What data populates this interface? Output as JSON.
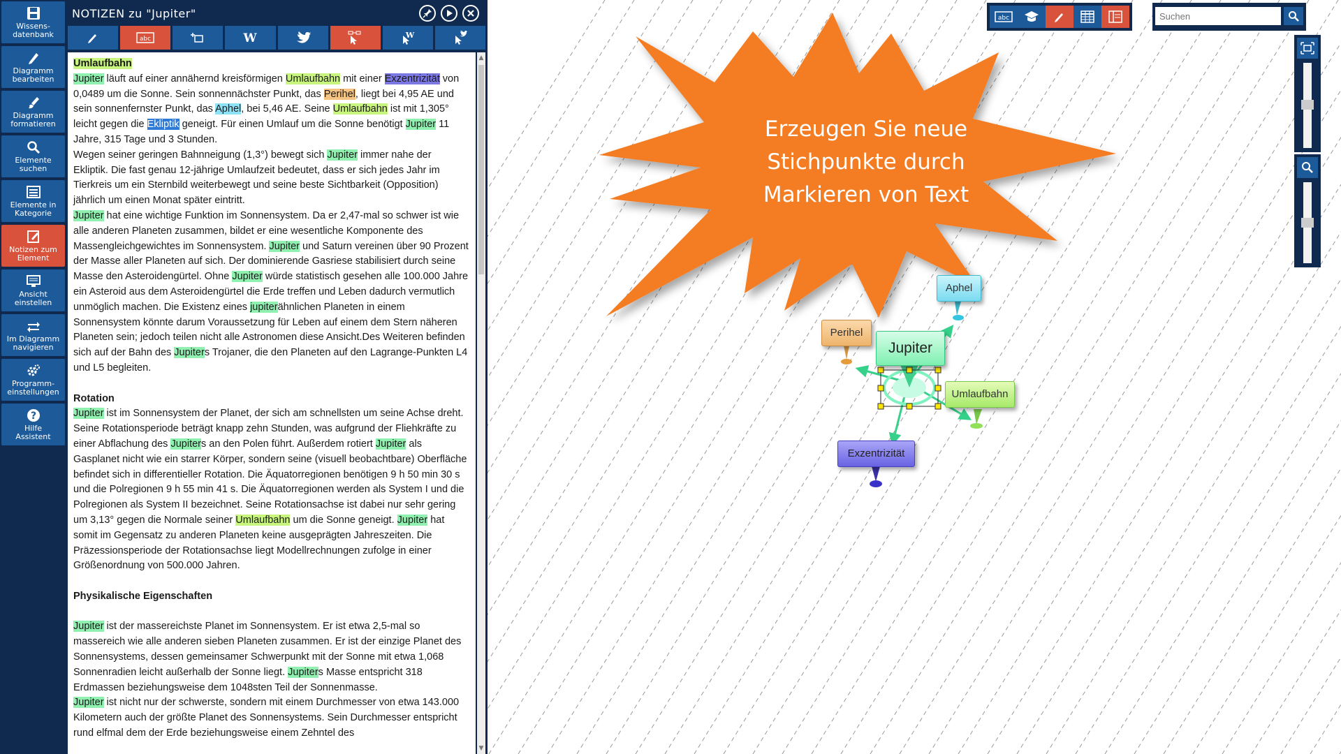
{
  "sidebar": {
    "items": [
      {
        "label": "Wissens-\ndatenbank",
        "active": false
      },
      {
        "label": "Diagramm\nbearbeiten",
        "active": false
      },
      {
        "label": "Diagramm\nformatieren",
        "active": false
      },
      {
        "label": "Elemente\nsuchen",
        "active": false
      },
      {
        "label": "Elemente in\nKategorie",
        "active": false
      },
      {
        "label": "Notizen zum\nElement",
        "active": true
      },
      {
        "label": "Ansicht\neinstellen",
        "active": false
      },
      {
        "label": "Im Diagramm\nnavigieren",
        "active": false
      },
      {
        "label": "Programm-\neinstellungen",
        "active": false
      },
      {
        "label": "Hilfe\nAssistent",
        "active": false
      }
    ]
  },
  "notes": {
    "title": "NOTIZEN zu \"Jupiter\"",
    "toolbar_icons": [
      "pencil-icon",
      "abc-icon",
      "crop-icon",
      "wikipedia-icon",
      "twitter-icon",
      "cursor-structure-icon",
      "cursor-wikipedia-icon",
      "cursor-twitter-icon"
    ],
    "sections": {
      "umlaufbahn": {
        "heading": "Umlaufbahn",
        "p1_segments": [
          {
            "t": "Jupiter",
            "c": "hl-j"
          },
          {
            "t": " läuft auf einer annähernd kreisförmigen ",
            "c": ""
          },
          {
            "t": "Umlaufbahn",
            "c": "hl-u"
          },
          {
            "t": " mit einer ",
            "c": ""
          },
          {
            "t": "Exzentrizität",
            "c": "hl-e"
          },
          {
            "t": " von 0,0489 um die Sonne. Sein sonnennächster Punkt, das ",
            "c": ""
          },
          {
            "t": "Perihel",
            "c": "hl-p"
          },
          {
            "t": ", liegt bei 4,95 AE und sein sonnenfernster Punkt, das ",
            "c": ""
          },
          {
            "t": "Aphel",
            "c": "hl-a"
          },
          {
            "t": ", bei 5,46 AE. Seine ",
            "c": ""
          },
          {
            "t": "Umlaufbahn",
            "c": "hl-u"
          },
          {
            "t": " ist mit 1,305° leicht gegen die ",
            "c": ""
          },
          {
            "t": "Ekliptik",
            "c": "hl-sel"
          },
          {
            "t": " geneigt. Für einen Umlauf um die Sonne benötigt ",
            "c": ""
          },
          {
            "t": "Jupiter",
            "c": "hl-j"
          },
          {
            "t": " 11 Jahre, 315 Tage und 3 Stunden.",
            "c": ""
          }
        ],
        "p2": "Wegen seiner geringen Bahnneigung (1,3°) bewegt sich Jupiter immer nahe der Ekliptik. Die fast genau 12-jährige Umlaufzeit bedeutet, dass er sich jedes Jahr im Tierkreis um ein Sternbild weiterbewegt und seine beste Sichtbarkeit (Opposition) jährlich um einen Monat später eintritt.",
        "p3": "Jupiter hat eine wichtige Funktion im Sonnensystem. Da er 2,47-mal so schwer ist wie alle anderen Planeten zusammen, bildet er eine wesentliche Komponente des Massengleichgewichtes im Sonnensystem. Jupiter und Saturn vereinen über 90 Prozent der Masse aller Planeten auf sich. Der dominierende Gasriese stabilisiert durch seine Masse den Asteroidengürtel. Ohne Jupiter würde statistisch gesehen alle 100.000 Jahre ein Asteroid aus dem Asteroidengürtel die Erde treffen und Leben dadurch vermutlich unmöglich machen. Die Existenz eines jupiterähnlichen Planeten in einem Sonnensystem könnte darum Voraussetzung für Leben auf einem dem Stern näheren Planeten sein; jedoch teilen nicht alle Astronomen diese Ansicht.Des Weiteren befinden sich auf der Bahn des Jupiters Trojaner, die den Planeten auf den Lagrange-Punkten L4 und L5 begleiten."
      },
      "rotation": {
        "heading": "Rotation",
        "p1": "Jupiter ist im Sonnensystem der Planet, der sich am schnellsten um seine Achse dreht. Seine Rotationsperiode beträgt knapp zehn Stunden, was aufgrund der Fliehkräfte zu einer Abflachung des Jupiters an den Polen führt. Außerdem rotiert Jupiter als Gasplanet nicht wie ein starrer Körper, sondern seine (visuell beobachtbare) Oberfläche befindet sich in differentieller Rotation. Die Äquatorregionen benötigen 9 h 50 min 30 s und die Polregionen 9 h 55 min 41 s. Die Äquatorregionen werden als System I und die Polregionen als System II bezeichnet. Seine Rotationsachse ist dabei nur sehr gering um 3,13° gegen die Normale seiner Umlaufbahn um die Sonne geneigt. Jupiter hat somit im Gegensatz zu anderen Planeten keine ausgeprägten Jahreszeiten. Die Präzessionsperiode der Rotationsachse liegt Modellrechnungen zufolge in einer Größenordnung von 500.000 Jahren."
      },
      "physik": {
        "heading": "Physikalische Eigenschaften",
        "p1": "Jupiter ist der massereichste Planet im Sonnensystem. Er ist etwa 2,5-mal so massereich wie alle anderen sieben Planeten zusammen. Er ist der einzige Planet des Sonnensystems, dessen gemeinsamer Schwerpunkt mit der Sonne mit etwa 1,068 Sonnenradien leicht außerhalb der Sonne liegt. Jupiters Masse entspricht 318 Erdmassen beziehungsweise dem 1048sten Teil der Sonnenmasse.",
        "p2": "Jupiter ist nicht nur der schwerste, sondern mit einem Durchmesser von etwa 143.000 Kilometern auch der größte Planet des Sonnensystems. Sein Durchmesser entspricht rund elfmal dem der Erde beziehungsweise einem Zehntel des"
      }
    }
  },
  "canvas": {
    "top_tools": [
      {
        "icon": "abc-icon",
        "active": false
      },
      {
        "icon": "graduation-cap-icon",
        "active": false
      },
      {
        "icon": "pencil-icon",
        "active": true
      },
      {
        "icon": "table-icon",
        "active": false
      },
      {
        "icon": "panel-icon",
        "active": true
      }
    ],
    "search": {
      "placeholder": "Suchen"
    },
    "callout": {
      "line1": "Erzeugen Sie neue",
      "line2": "Stichpunkte durch",
      "line3": "Markieren von Text"
    },
    "nodes": {
      "center": "Jupiter",
      "perihel": "Perihel",
      "aphel": "Aphel",
      "umlaufbahn": "Umlaufbahn",
      "exzentrizitaet": "Exzentrizität"
    },
    "colors": {
      "accent_orange": "#f47b20",
      "sidebar_bg": "#0f2a4e",
      "button_blue": "#1d5a9a",
      "active_red": "#d9523c"
    }
  }
}
